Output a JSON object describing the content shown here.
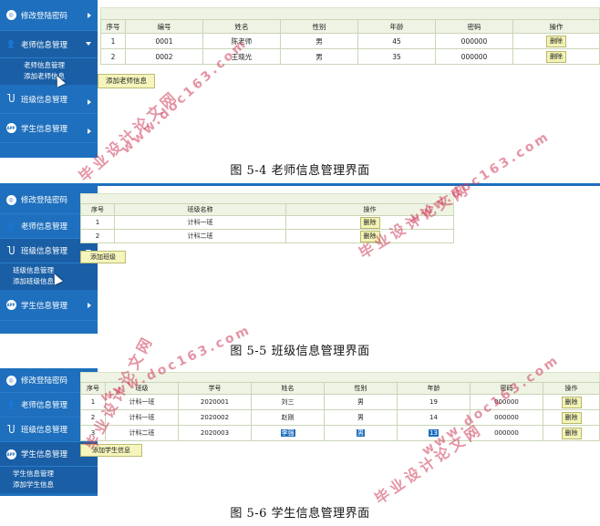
{
  "menu": {
    "change_password": "修改登陆密码",
    "teacher_mgmt": "老师信息管理",
    "class_mgmt": "班级信息管理",
    "student_mgmt": "学生信息管理",
    "teacher_sub": [
      "老师信息管理",
      "添加老师信息"
    ],
    "class_sub": [
      "班级信息管理",
      "添加班级信息"
    ],
    "student_sub": [
      "学生信息管理",
      "添加学生信息"
    ]
  },
  "fig1": {
    "headers": [
      "序号",
      "编号",
      "姓名",
      "性别",
      "年龄",
      "密码",
      "操作"
    ],
    "rows": [
      [
        "1",
        "0001",
        "陈老师",
        "男",
        "45",
        "000000"
      ],
      [
        "2",
        "0002",
        "王晓光",
        "男",
        "35",
        "000000"
      ]
    ],
    "delete_label": "删除",
    "add_label": "添加老师信息",
    "caption": "图 5-4  老师信息管理界面"
  },
  "fig2": {
    "headers": [
      "序号",
      "班级名称",
      "操作"
    ],
    "rows": [
      [
        "1",
        "计科一班"
      ],
      [
        "2",
        "计科二班"
      ]
    ],
    "delete_label": "删除",
    "add_label": "添加班级",
    "caption": "图 5-5  班级信息管理界面"
  },
  "fig3": {
    "headers": [
      "序号",
      "班级",
      "学号",
      "姓名",
      "性别",
      "年龄",
      "密码",
      "操作"
    ],
    "rows": [
      [
        "1",
        "计科一班",
        "2020001",
        "刘三",
        "男",
        "19",
        "000000"
      ],
      [
        "2",
        "计科一班",
        "2020002",
        "赵刚",
        "男",
        "14",
        "000000"
      ],
      [
        "3",
        "计科二班",
        "2020003",
        "李强",
        "男",
        "13",
        "000000"
      ]
    ],
    "delete_label": "删除",
    "add_label": "添加学生信息",
    "caption": "图 5-6 学生信息管理界面"
  },
  "watermark": {
    "cn": "毕业设计论文网",
    "url": "www.doc163.com"
  },
  "icons": {
    "menu_password": "password-icon",
    "menu_teacher": "user-icon",
    "menu_class": "class-icon",
    "menu_student": "app-icon"
  }
}
